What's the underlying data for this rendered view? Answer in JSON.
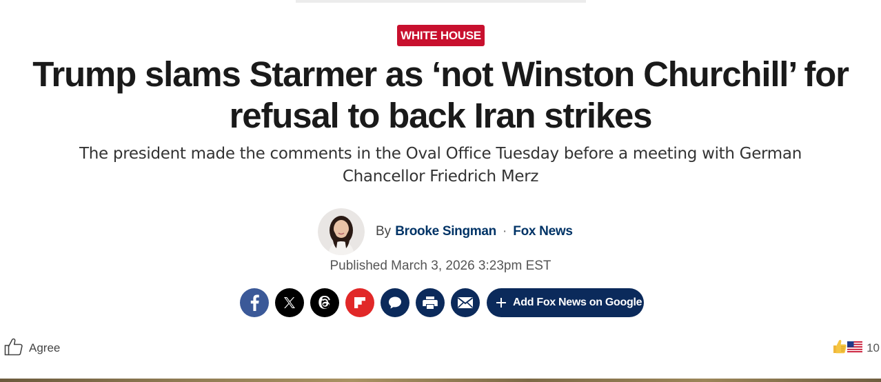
{
  "article": {
    "category": "WHITE HOUSE",
    "headline": "Trump slams Starmer as ‘not Winston Churchill’ for refusal to back Iran strikes",
    "subheadline": "The president made the comments in the Oval Office Tuesday before a meeting with German Chancellor Friedrich Merz",
    "byline": {
      "prefix": "By",
      "author": "Brooke Singman",
      "separator": "·",
      "source": "Fox News"
    },
    "published": "Published March 3, 2026 3:23pm EST"
  },
  "share": {
    "buttons": [
      {
        "name": "facebook",
        "icon": "facebook-icon",
        "color": "#3b5998"
      },
      {
        "name": "x",
        "icon": "x-icon",
        "color": "#000000"
      },
      {
        "name": "threads",
        "icon": "threads-icon",
        "color": "#000000"
      },
      {
        "name": "flipboard",
        "icon": "flipboard-icon",
        "color": "#e12828"
      },
      {
        "name": "comments",
        "icon": "comment-bubble-icon",
        "color": "#0b2a5b"
      },
      {
        "name": "print",
        "icon": "printer-icon",
        "color": "#0b2a5b"
      },
      {
        "name": "email",
        "icon": "envelope-icon",
        "color": "#0b2a5b"
      }
    ],
    "add_google_label": "Add Fox News on Google"
  },
  "reactions": {
    "agree_label": "Agree",
    "count": "10"
  },
  "colors": {
    "category_badge": "#c8102e",
    "link": "#003366",
    "button_navy": "#0b2a5b"
  }
}
